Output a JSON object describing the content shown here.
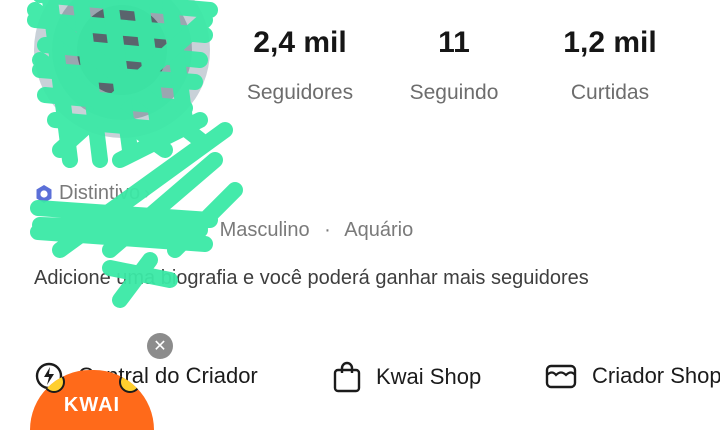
{
  "profile": {
    "stats": [
      {
        "value": "2,4 mil",
        "label": "Seguidores"
      },
      {
        "value": "11",
        "label": "Seguindo"
      },
      {
        "value": "1,2 mil",
        "label": "Curtidas"
      }
    ],
    "badge_label": "Distintivo",
    "gender": "Masculino",
    "zodiac": "Aquário",
    "bio_placeholder": "Adicione uma biografia e você poderá ganhar mais seguidores"
  },
  "tools": {
    "creator_center": "Central do Criador",
    "kwai_shop": "Kwai Shop",
    "criador_shop": "Criador Shop"
  },
  "promo": {
    "brand": "KWAI",
    "close_glyph": "✕"
  },
  "colors": {
    "redaction": "#3be9a6",
    "promo_orange": "#ff6a1a",
    "badge_icon": "#5b6fd8"
  }
}
